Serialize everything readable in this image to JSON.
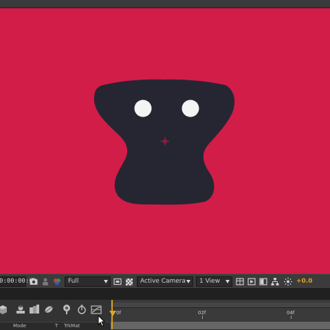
{
  "viewer": {
    "background_color": "#d21d48",
    "character_color": "#262633",
    "eye_color": "#f4f4f4",
    "anchor_color": "#c8143c"
  },
  "viewer_bar": {
    "timecode": "0:00:00:00",
    "resolution": "Full",
    "camera": "Active Camera",
    "view_layout": "1 View",
    "exposure": "+0.0",
    "icons": [
      "snapshot-icon",
      "show-snapshot-icon",
      "color-channel-icon",
      "region-of-interest-icon",
      "transparency-grid-icon",
      "grid-guides-icon",
      "fast-preview-icon",
      "toggle-mask-icon",
      "flowchart-icon",
      "exposure-reset-icon"
    ]
  },
  "timeline": {
    "ruler_labels": [
      "0f",
      "02f",
      "04f"
    ],
    "columns": {
      "mode": "Mode",
      "t": "T",
      "trkmat": "TrkMat"
    },
    "icons": [
      "3d-draft-icon",
      "shy-layers-icon",
      "frame-blending-icon",
      "motion-blur-icon",
      "brainstorm-icon",
      "auto-keyframe-icon",
      "graph-editor-icon"
    ]
  }
}
